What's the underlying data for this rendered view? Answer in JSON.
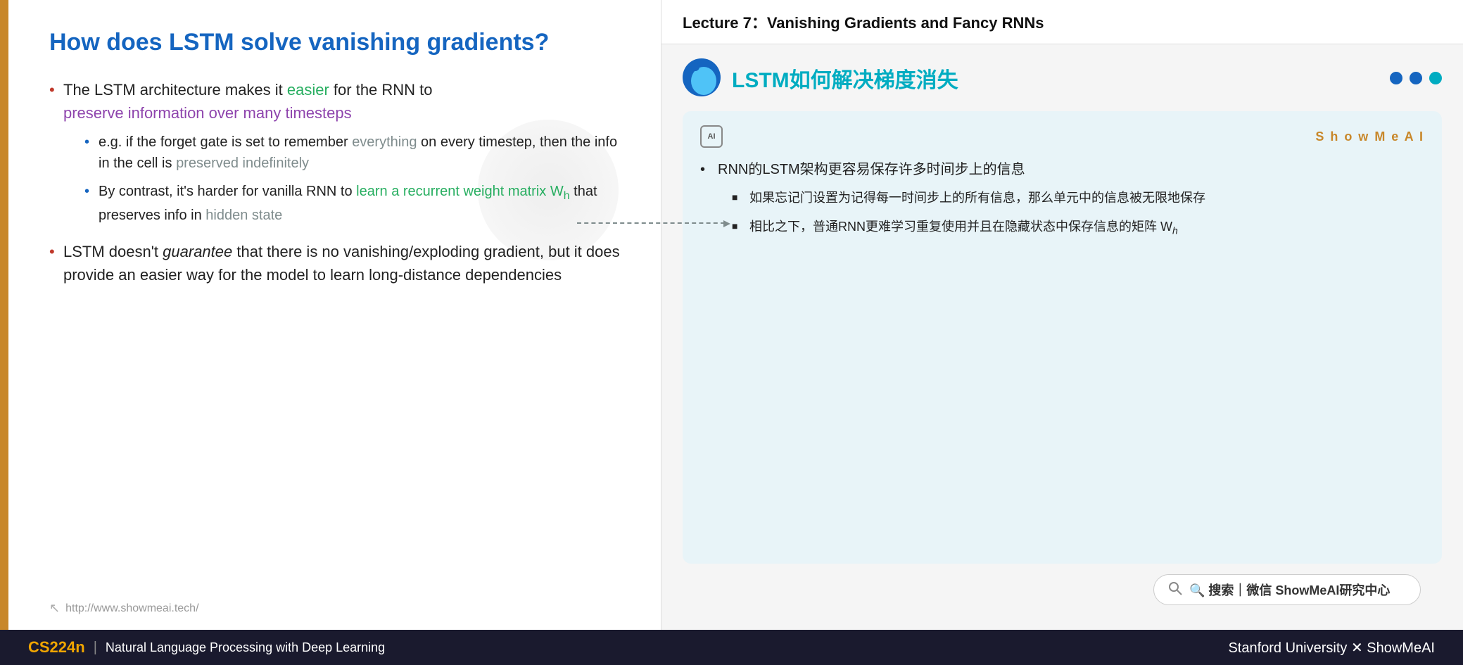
{
  "header": {
    "lecture_title": "Lecture 7：Vanishing Gradients and Fancy RNNs"
  },
  "left_slide": {
    "title": "How does LSTM solve vanishing gradients?",
    "bullet1_main": "The LSTM architecture makes it ",
    "bullet1_easier": "easier",
    "bullet1_cont": " for the RNN to ",
    "bullet1_purple": "preserve information over many timesteps",
    "sub_bullet1": "e.g. if the forget gate is set to remember ",
    "sub_bullet1_gray": "everything",
    "sub_bullet1_cont": " on every timestep, then the info in the cell is ",
    "sub_bullet1_gray2": "preserved indefinitely",
    "sub_bullet2_start": "By contrast, it's harder for vanilla RNN to ",
    "sub_bullet2_green": "learn a recurrent weight matrix W",
    "sub_bullet2_sub": "h",
    "sub_bullet2_end": " that preserves info in ",
    "sub_bullet2_gray": "hidden state",
    "bullet2": "LSTM doesn't ",
    "bullet2_italic": "guarantee",
    "bullet2_cont": " that there is no vanishing/exploding gradient, but it does provide an easier way for the model to learn long-distance dependencies",
    "footer_url": "http://www.showmeai.tech/"
  },
  "right_panel": {
    "chinese_title": "LSTM如何解决梯度消失",
    "showmeai_label": "S h o w M e A I",
    "bullet1_chinese": "RNN的LSTM架构更容易保存许多时间步上的信息",
    "sub1_chinese": "如果忘记门设置为记得每一时间步上的所有信息，那么单元中的信息被无限地保存",
    "sub2_chinese": "相比之下，普通RNN更难学习重复使用并且在隐藏状态中保存信息的矩阵 W",
    "sub2_wh": "h",
    "search_text": "🔍 搜索｜微信 ShowMeAI研究中心"
  },
  "bottom_bar": {
    "cs224n": "CS224n",
    "divider": "|",
    "course_name": "Natural Language Processing with Deep Learning",
    "right_text": "Stanford University  ✕  ShowMeAI"
  },
  "nav_dots": [
    "dot1",
    "dot2",
    "dot3"
  ],
  "colors": {
    "accent_orange": "#c8872a",
    "accent_blue": "#1565c0",
    "accent_cyan": "#00acc1",
    "accent_purple": "#8e44ad",
    "accent_green": "#27ae60",
    "bottom_bg": "#1a1a2e"
  }
}
